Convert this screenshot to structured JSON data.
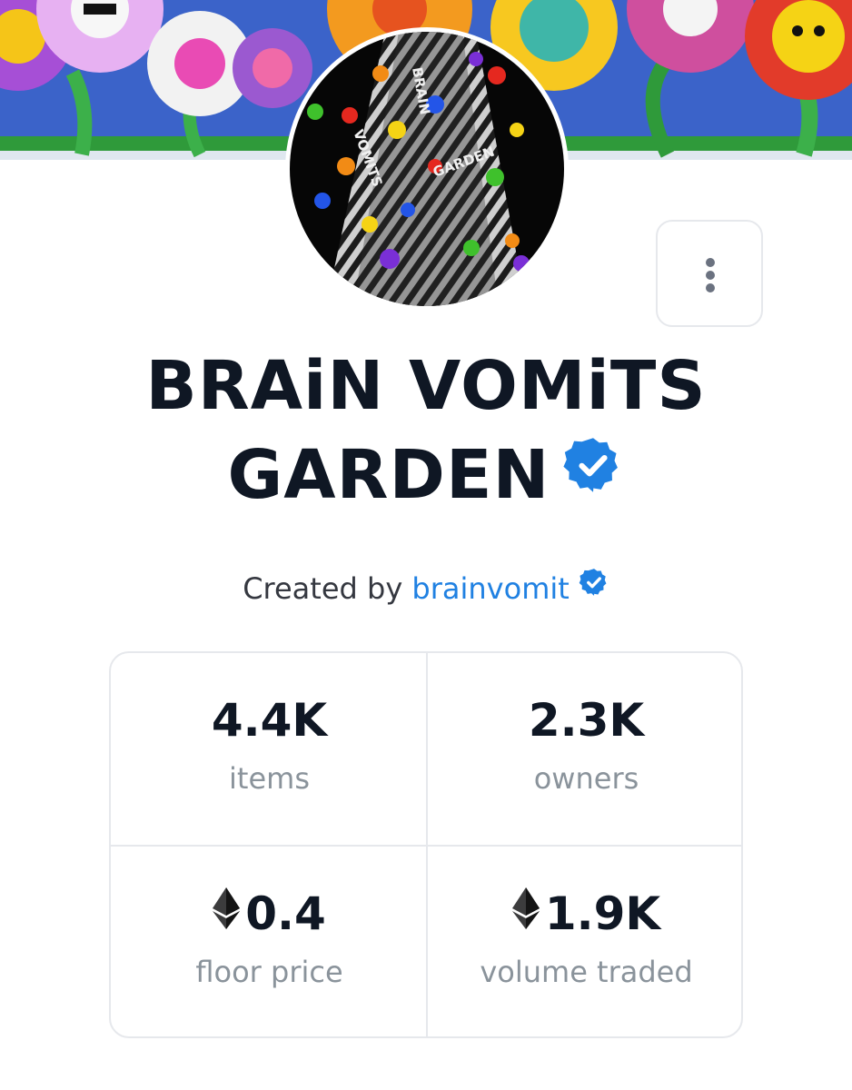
{
  "collection": {
    "title_line1": "BRAiN VOMiTS",
    "title_line2": "GARDEN",
    "verified_icon": "verified-badge-icon",
    "creator_prefix": "Created by",
    "creator_name": "brainvomit",
    "avatar_text": "BRAIN VOMITS GARDEN"
  },
  "menu": {
    "icon": "more-vertical-icon"
  },
  "stats": [
    {
      "value": "4.4K",
      "label": "items",
      "currency_icon": ""
    },
    {
      "value": "2.3K",
      "label": "owners",
      "currency_icon": ""
    },
    {
      "value": "0.4",
      "label": "floor price",
      "currency_icon": "ethereum-icon"
    },
    {
      "value": "1.9K",
      "label": "volume traded",
      "currency_icon": "ethereum-icon"
    }
  ],
  "colors": {
    "accent": "#2081e2",
    "title": "#0f1724",
    "muted": "#8a939b",
    "border": "#e6e8ec"
  }
}
